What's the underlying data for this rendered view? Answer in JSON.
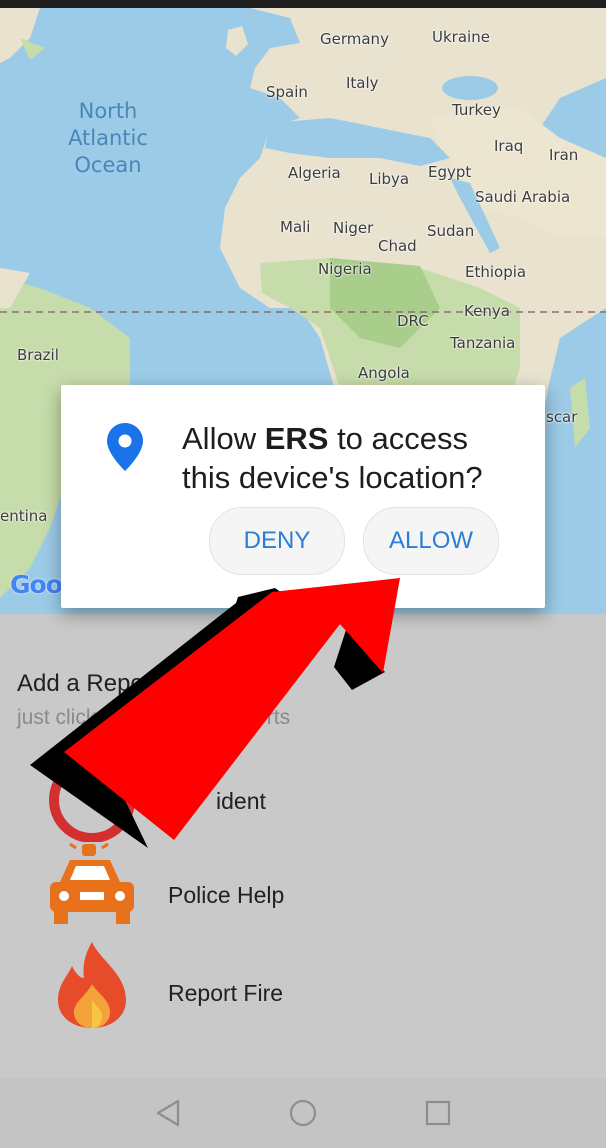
{
  "map": {
    "ocean_label": "North Atlantic Ocean",
    "labels": [
      {
        "id": "germany",
        "text": "Germany"
      },
      {
        "id": "ukraine",
        "text": "Ukraine"
      },
      {
        "id": "spain",
        "text": "Spain"
      },
      {
        "id": "italy",
        "text": "Italy"
      },
      {
        "id": "turkey",
        "text": "Turkey"
      },
      {
        "id": "iraq",
        "text": "Iraq"
      },
      {
        "id": "iran",
        "text": "Iran"
      },
      {
        "id": "algeria",
        "text": "Algeria"
      },
      {
        "id": "libya",
        "text": "Libya"
      },
      {
        "id": "egypt",
        "text": "Egypt"
      },
      {
        "id": "saudi-arabia",
        "text": "Saudi Arabia"
      },
      {
        "id": "mali",
        "text": "Mali"
      },
      {
        "id": "niger",
        "text": "Niger"
      },
      {
        "id": "chad",
        "text": "Chad"
      },
      {
        "id": "sudan",
        "text": "Sudan"
      },
      {
        "id": "nigeria",
        "text": "Nigeria"
      },
      {
        "id": "ethiopia",
        "text": "Ethiopia"
      },
      {
        "id": "kenya",
        "text": "Kenya"
      },
      {
        "id": "drc",
        "text": "DRC"
      },
      {
        "id": "tanzania",
        "text": "Tanzania"
      },
      {
        "id": "brazil",
        "text": "Brazil"
      },
      {
        "id": "angola",
        "text": "Angola"
      },
      {
        "id": "madagascar",
        "text": "scar"
      },
      {
        "id": "argentina",
        "text": "entina"
      }
    ],
    "google_logo": "Goo"
  },
  "dialog": {
    "text_before": "Allow ",
    "app_name": "ERS",
    "text_after": " to access this device's location?",
    "deny_label": "DENY",
    "allow_label": "ALLOW",
    "pin_color": "#1a73e8"
  },
  "report_section": {
    "title": "Add a Report",
    "subtitle": "just click the ... to add reports",
    "items": [
      {
        "label": "Accident",
        "visible_label": "ident",
        "icon": "accident-icon"
      },
      {
        "label": "Police Help",
        "icon": "police-car-icon"
      },
      {
        "label": "Report Fire",
        "icon": "fire-icon"
      }
    ]
  },
  "colors": {
    "accent_blue": "#2a7fd4",
    "annotation_arrow": "#ff0000",
    "police_orange": "#e8711c"
  },
  "nav_bar": {
    "back": "back-icon",
    "home": "home-icon",
    "recents": "recents-icon"
  }
}
